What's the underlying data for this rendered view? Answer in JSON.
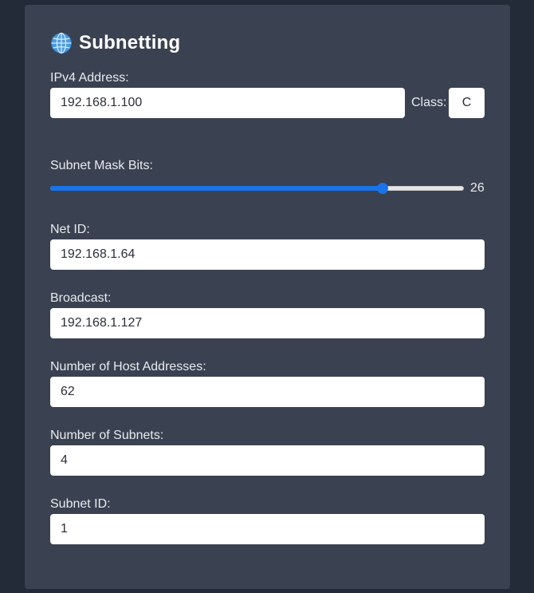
{
  "app": {
    "title": "Subnetting"
  },
  "ipv4": {
    "label": "IPv4 Address:",
    "value": "192.168.1.100"
  },
  "class": {
    "label": "Class:",
    "value": "C"
  },
  "subnet_mask": {
    "label": "Subnet Mask Bits:",
    "value": "26",
    "min": 0,
    "max": 32,
    "level": 26
  },
  "net_id": {
    "label": "Net ID:",
    "value": "192.168.1.64"
  },
  "broadcast": {
    "label": "Broadcast:",
    "value": "192.168.1.127"
  },
  "host_count": {
    "label": "Number of Host Addresses:",
    "value": "62"
  },
  "subnet_count": {
    "label": "Number of Subnets:",
    "value": "4"
  },
  "subnet_id": {
    "label": "Subnet ID:",
    "value": "1"
  },
  "colors": {
    "page_bg": "#232a38",
    "card_bg": "#3a4150",
    "accent": "#1a73e8"
  },
  "icons": {
    "title_icon": "globe-icon"
  }
}
